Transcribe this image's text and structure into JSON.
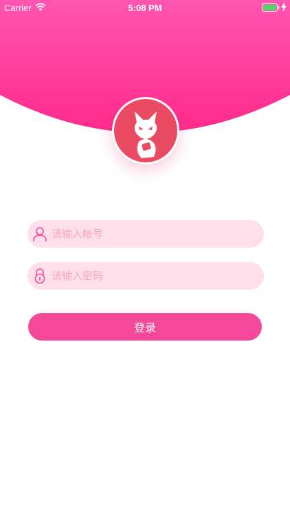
{
  "status_bar": {
    "carrier": "Carrier",
    "time": "5:08 PM",
    "wifi_icon": "wifi-icon",
    "battery_icon": "battery-icon",
    "charging_icon": "charging-bolt-icon"
  },
  "logo": {
    "icon": "fox-mascot-icon"
  },
  "login_form": {
    "account": {
      "placeholder": "请输入帐号",
      "value": "",
      "icon": "user-icon"
    },
    "password": {
      "placeholder": "请输入密码",
      "value": "",
      "icon": "lock-icon"
    },
    "submit_label": "登录"
  },
  "colors": {
    "header_gradient_top": "#ff4fab",
    "header_gradient_bottom": "#ff2e8e",
    "input_bg": "#ffe0ea",
    "placeholder": "#f7a6be",
    "button": "#f6489a",
    "logo_bg": "#eb4a63"
  }
}
